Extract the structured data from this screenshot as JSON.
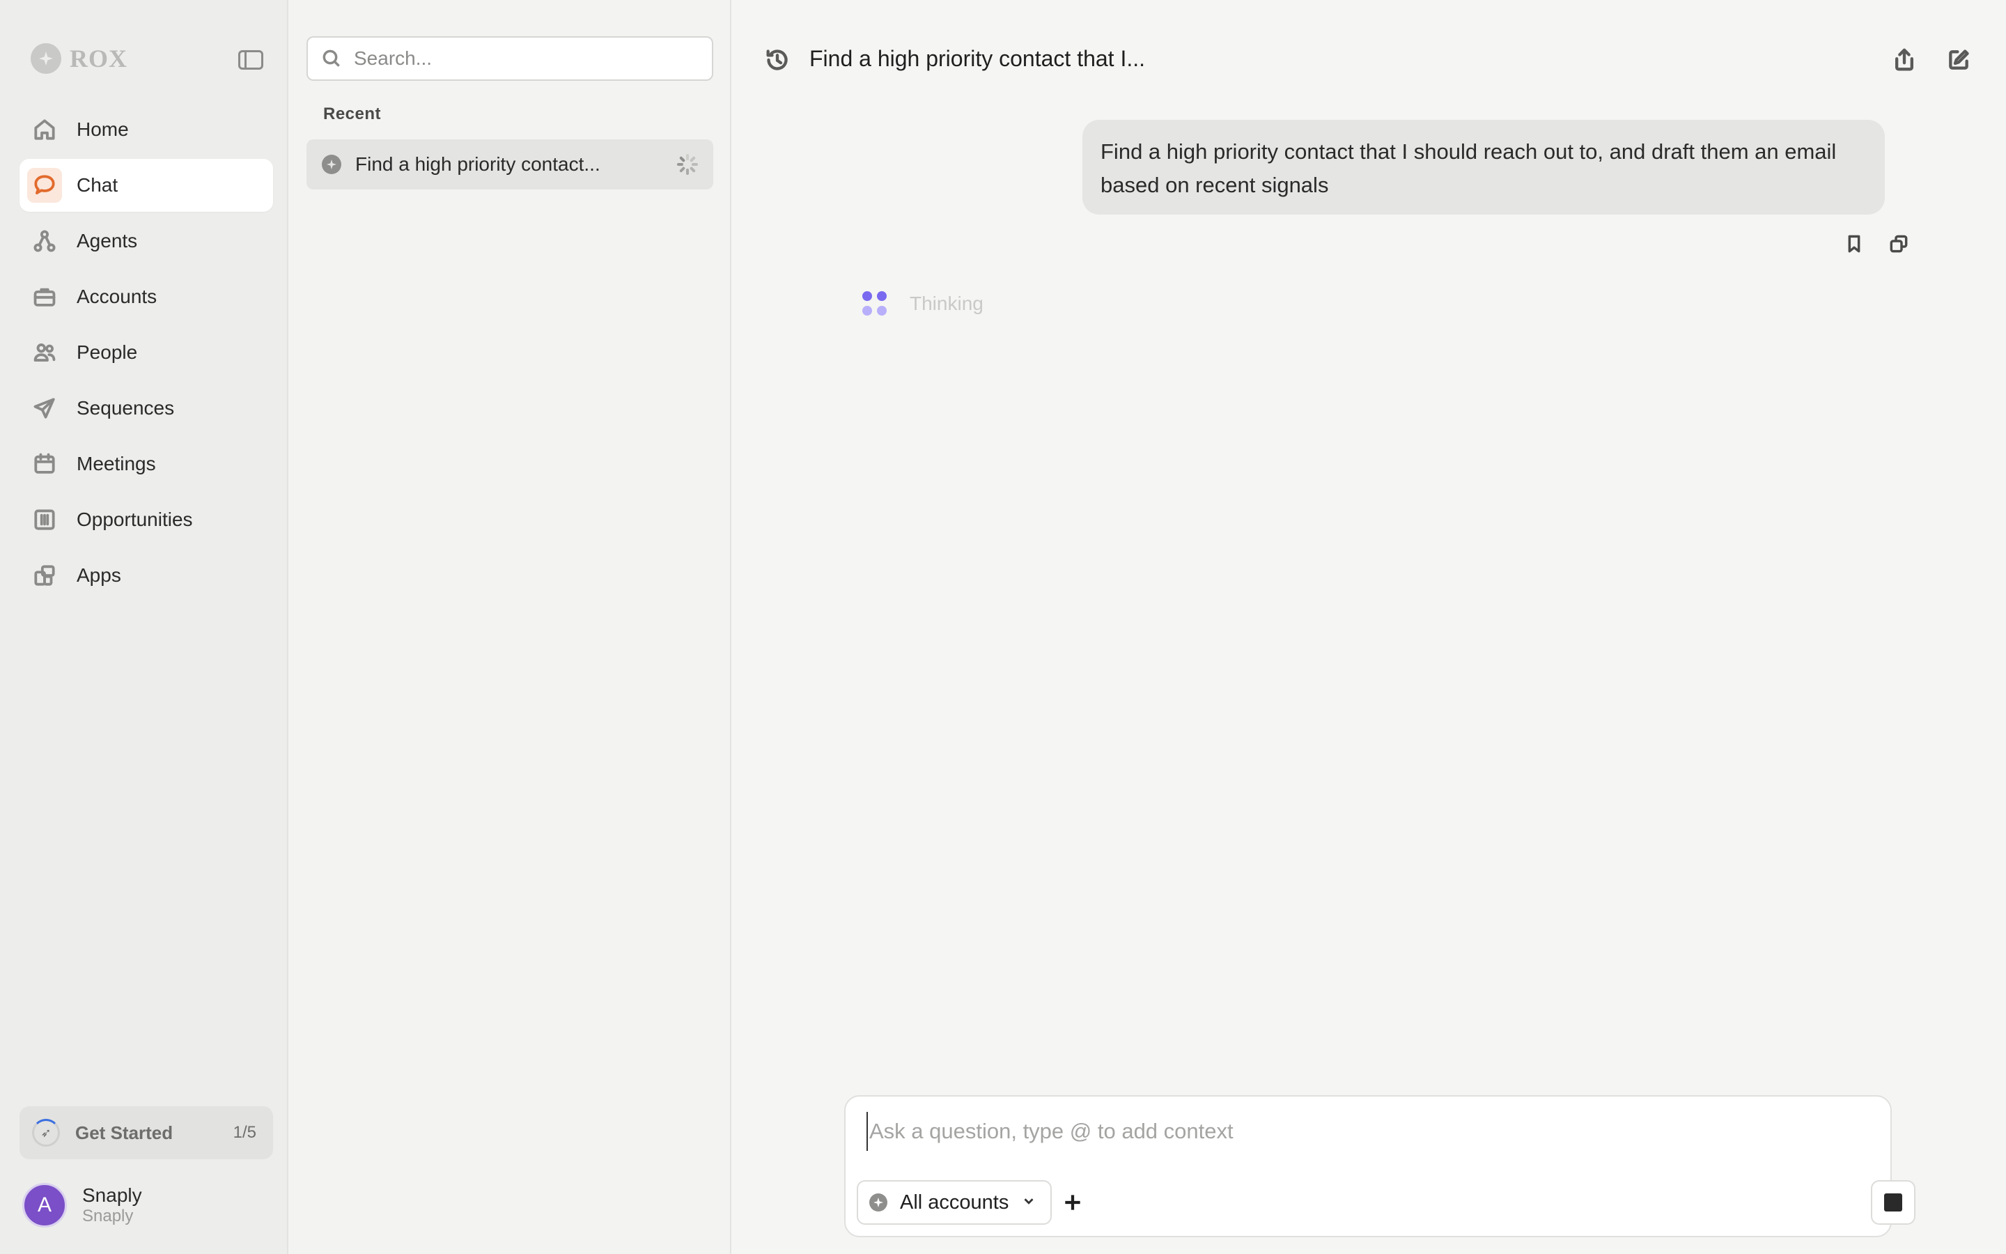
{
  "brand": {
    "name": "ROX",
    "logo_icon": "rox-star-icon"
  },
  "sidebar": {
    "items": [
      {
        "label": "Home",
        "icon": "home-icon",
        "active": false
      },
      {
        "label": "Chat",
        "icon": "chat-bubble-icon",
        "active": true
      },
      {
        "label": "Agents",
        "icon": "agents-icon",
        "active": false
      },
      {
        "label": "Accounts",
        "icon": "briefcase-icon",
        "active": false
      },
      {
        "label": "People",
        "icon": "people-icon",
        "active": false
      },
      {
        "label": "Sequences",
        "icon": "paper-plane-icon",
        "active": false
      },
      {
        "label": "Meetings",
        "icon": "calendar-icon",
        "active": false
      },
      {
        "label": "Opportunities",
        "icon": "columns-icon",
        "active": false
      },
      {
        "label": "Apps",
        "icon": "apps-icon",
        "active": false
      }
    ],
    "get_started": {
      "label": "Get Started",
      "count": "1/5"
    },
    "profile": {
      "initial": "A",
      "name": "Snaply",
      "org": "Snaply"
    }
  },
  "history": {
    "search_placeholder": "Search...",
    "recent_label": "Recent",
    "items": [
      {
        "label": "Find a high priority contact..."
      }
    ]
  },
  "main": {
    "title": "Find a high priority contact that I...",
    "user_message": "Find a high priority contact that I should reach out to, and draft them an email based on recent signals",
    "thinking_label": "Thinking",
    "composer": {
      "placeholder": "Ask a question, type @ to add context",
      "value": "",
      "scope_label": "All accounts"
    }
  },
  "colors": {
    "accent": "#e26a2c",
    "avatar": "#7b4fc7",
    "thinking_dots": "#7a6af0"
  }
}
